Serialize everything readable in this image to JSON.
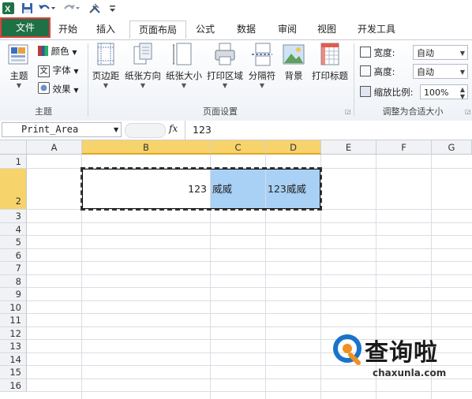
{
  "ribbon_tabs": [
    "文件",
    "开始",
    "插入",
    "页面布局",
    "公式",
    "数据",
    "审阅",
    "视图",
    "开发工具"
  ],
  "themes": {
    "themes_label": "主题",
    "colors_label": "颜色",
    "fonts_label": "字体",
    "effects_label": "效果",
    "group_label": "主题"
  },
  "page_setup": {
    "margins_label": "页边距",
    "orientation_label": "纸张方向",
    "size_label": "纸张大小",
    "print_area_label": "打印区域",
    "breaks_label": "分隔符",
    "background_label": "背景",
    "print_titles_label": "打印标题",
    "group_label": "页面设置"
  },
  "scale_to_fit": {
    "width_label": "宽度:",
    "width_value": "自动",
    "height_label": "高度:",
    "height_value": "自动",
    "scale_label": "缩放比例:",
    "scale_value": "100%",
    "group_label": "调整为合适大小"
  },
  "formula_bar": {
    "name_box": "Print_Area",
    "fx": "fx",
    "formula": "123"
  },
  "columns": [
    "A",
    "B",
    "C",
    "D",
    "E",
    "F",
    "G"
  ],
  "rows": [
    "1",
    "2",
    "3",
    "4",
    "5",
    "6",
    "7",
    "8",
    "9",
    "10",
    "11",
    "12",
    "13",
    "14",
    "15",
    "16"
  ],
  "cells": {
    "B2": "123",
    "C2": "威威",
    "D2": "123威威"
  },
  "watermark": {
    "brand": "查询啦",
    "domain": "chaxunla.com"
  },
  "colors": {
    "file_tab": "#1e7145",
    "selected_header": "#f7d36b",
    "cell_fill": "#a9d0f5",
    "watermark_blue": "#1a73c9"
  }
}
